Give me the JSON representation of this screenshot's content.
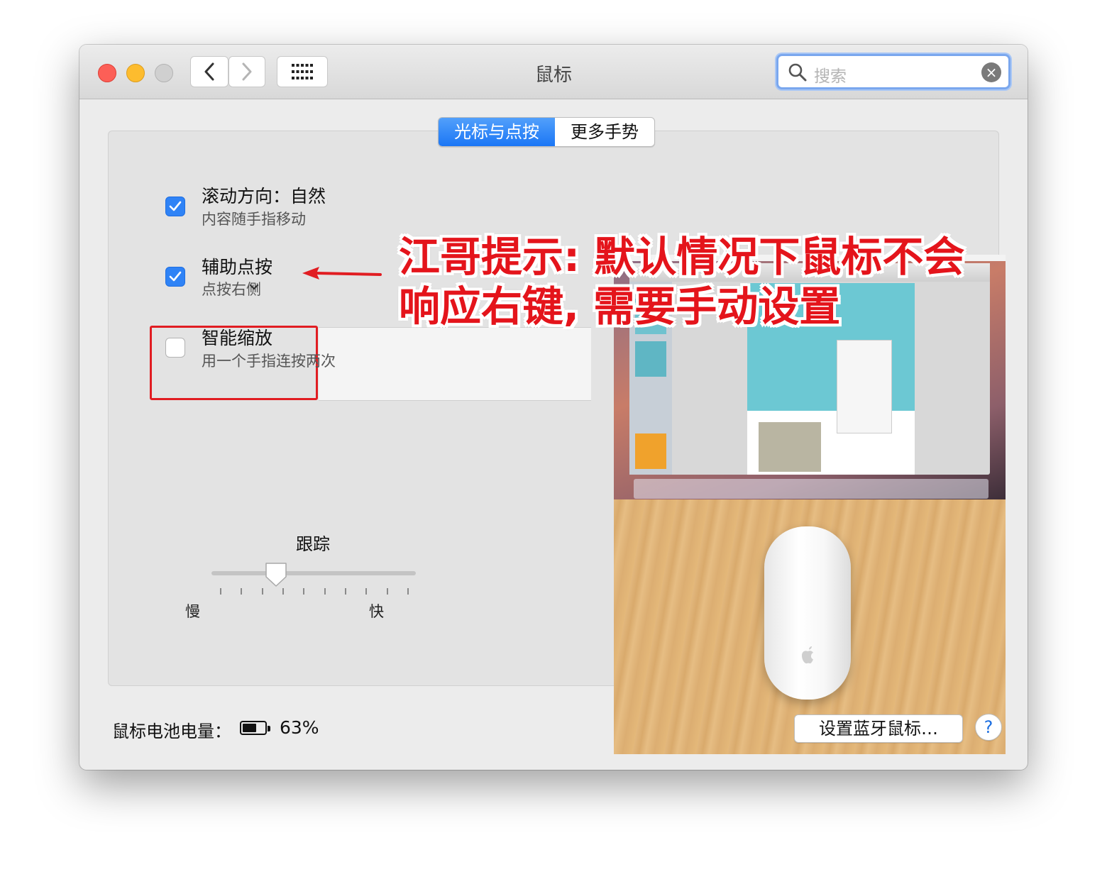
{
  "window": {
    "title": "鼠标"
  },
  "search": {
    "placeholder": "搜索"
  },
  "tabs": [
    {
      "label": "光标与点按",
      "active": true
    },
    {
      "label": "更多手势",
      "active": false
    }
  ],
  "options": [
    {
      "label": "滚动方向：自然",
      "sub": "内容随手指移动",
      "checked": true
    },
    {
      "label": "辅助点按",
      "sub": "点按右侧",
      "checked": true
    },
    {
      "label": "智能缩放",
      "sub": "用一个手指连按两次",
      "checked": false
    }
  ],
  "tracking": {
    "title": "跟踪",
    "slow": "慢",
    "fast": "快",
    "level": 0.3
  },
  "annotation": {
    "line1": "江哥提示: 默认情况下鼠标不会",
    "line2": "响应右键, 需要手动设置",
    "color": "#e4141b"
  },
  "battery": {
    "label": "鼠标电池电量：",
    "percent_text": "63%",
    "level": 0.63
  },
  "buttons": {
    "bluetooth": "设置蓝牙鼠标…",
    "help": "?"
  },
  "colors": {
    "accent": "#2f83f6",
    "highlight": "#e11d22"
  }
}
